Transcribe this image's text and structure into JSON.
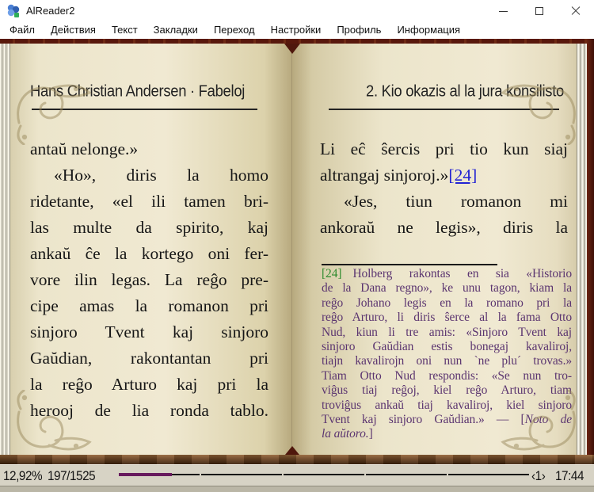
{
  "titlebar": {
    "title": "AlReader2"
  },
  "menu": {
    "items": [
      "Файл",
      "Действия",
      "Текст",
      "Закладки",
      "Переход",
      "Настройки",
      "Профиль",
      "Информация"
    ]
  },
  "left_page": {
    "header": "Hans Christian Andersen · Fabeloj",
    "lines": [
      "antaŭ nelonge.»",
      "«Ho», diris la homo",
      "ridetante, «el ili tamen bri-",
      "las multe da spirito, kaj",
      "ankaŭ ĉe la kortego oni fer-",
      "vore ilin legas. La reĝo pre-",
      "cipe amas la romanon pri",
      "sinjoro Tvent kaj sinjoro",
      "Gaŭdian, rakontantan pri",
      "la reĝo Arturo kaj pri la",
      "herooj de lia ronda tablo."
    ]
  },
  "right_page": {
    "header": "2. Kio okazis al la jura konsilisto",
    "line1": "Li eĉ ŝercis pri tio kun siaj",
    "line2_pre": "altrangaj sinjoroj.»",
    "line2_link": "[24]",
    "line3": "«Jes, tiun romanon mi",
    "line4": "ankoraŭ ne legis», diris la",
    "footnote": {
      "marker": "[24]",
      "first_line": "Holberg rakontas en sia «Historio",
      "lines": [
        "de la Dana regno», ke unu tagon, kiam la",
        "reĝo Johano legis en la romano pri la",
        "reĝo Arturo, li diris ŝerce al la fama Otto",
        "Nud, kiun li tre amis: «Sinjoro Tvent kaj",
        "sinjoro Gaŭdian estis bonegaj kavaliroj,",
        "tiajn kavalirojn oni nun `ne plu´ trovas.»",
        "Tiam Otto Nud respondis: «Se nun tro-",
        "viĝus tiaj reĝoj, kiel reĝo Arturo, tiam",
        "troviĝus ankaŭ tiaj kavaliroj, kiel sinjoro"
      ],
      "line11_pre": "Tvent kaj sinjoro Gaŭdian.» — [",
      "line11_italic": "Noto de",
      "line12_italic": "la aŭtoro.",
      "line12_post": "]"
    }
  },
  "status_bar": {
    "percent": "12,92%",
    "position": "197/1525",
    "indicator": "‹1›",
    "time": "17:44",
    "progress_fraction": 0.1292
  },
  "icons": {
    "app": "alreader-app-icon",
    "minimize": "minimize-icon",
    "maximize": "maximize-icon",
    "close": "close-icon",
    "corner_ornament": "floral-corner-ornament"
  },
  "colors": {
    "page_background": "#efe8d0",
    "cover_maroon": "#4f170c",
    "body_text": "#161616",
    "footnote_text": "#5b3570",
    "footnote_marker_green": "#2e8b2e",
    "link_blue": "#2323d3",
    "progress_fill_purple": "#671a5e",
    "status_bar_background": "#d7d3c5"
  }
}
